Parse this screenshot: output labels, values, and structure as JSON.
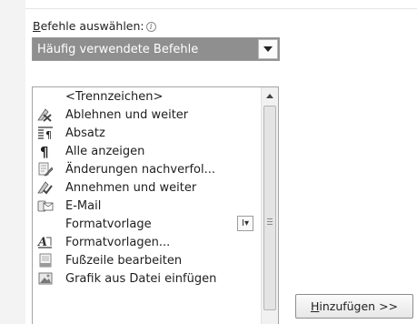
{
  "commands": {
    "label_accel": "B",
    "label_rest": "efehle auswählen:",
    "info_glyph": "i",
    "dropdown": {
      "value": "Häufig verwendete Befehle"
    }
  },
  "list": {
    "items": [
      {
        "label": "<Trennzeichen>",
        "icon": "none"
      },
      {
        "label": "Ablehnen und weiter",
        "icon": "reject-next-icon"
      },
      {
        "label": "Absatz",
        "icon": "paragraph-format-icon"
      },
      {
        "label": "Alle anzeigen",
        "icon": "pilcrow-icon"
      },
      {
        "label": "Änderungen nachverfol...",
        "icon": "track-changes-icon"
      },
      {
        "label": "Annehmen und weiter",
        "icon": "accept-next-icon"
      },
      {
        "label": "E-Mail",
        "icon": "email-icon"
      },
      {
        "label": "Formatvorlage",
        "icon": "none",
        "submenu_glyph": "I▾"
      },
      {
        "label": "Formatvorlagen...",
        "icon": "styles-icon"
      },
      {
        "label": "Fußzeile bearbeiten",
        "icon": "footer-icon"
      },
      {
        "label": "Grafik aus Datei einfügen",
        "icon": "picture-icon"
      }
    ]
  },
  "add_button": {
    "accel": "H",
    "rest": "inzufügen >>"
  }
}
